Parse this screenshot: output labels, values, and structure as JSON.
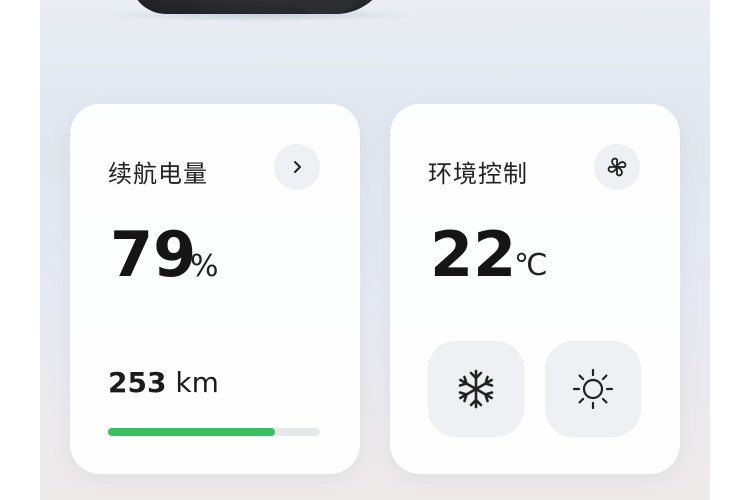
{
  "battery": {
    "title": "续航电量",
    "percent": "79",
    "unit": "%",
    "range_value": "253",
    "range_unit": "km",
    "fill_fraction": 0.79,
    "fill_color": "#33c35a",
    "arrow_icon": "chevron-right-icon"
  },
  "climate": {
    "title": "环境控制",
    "temperature": "22",
    "unit": "℃",
    "fan_icon": "fan-icon",
    "cool_icon": "snowflake-icon",
    "heat_icon": "sun-icon"
  }
}
